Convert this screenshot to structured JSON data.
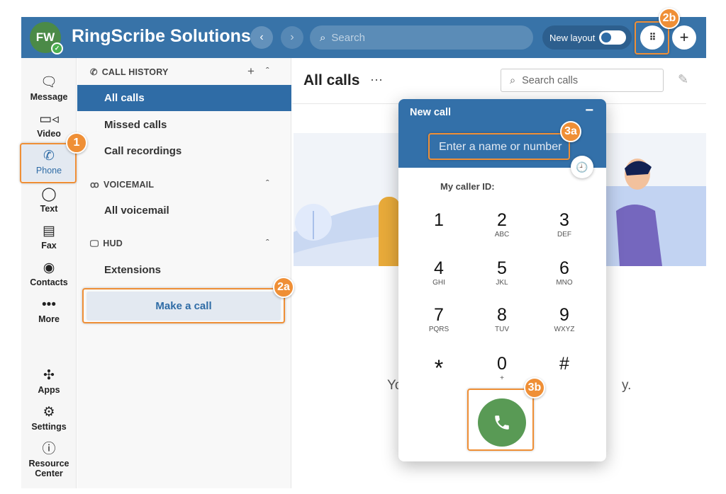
{
  "header": {
    "avatar_initials": "FW",
    "app_title": "RingScribe Solutions",
    "search_placeholder": "Search",
    "new_layout_label": "New layout",
    "new_layout_on": true,
    "brand_color": "#3873a8"
  },
  "rail": {
    "items": [
      {
        "label": "Message",
        "icon": "message-icon"
      },
      {
        "label": "Video",
        "icon": "video-icon"
      },
      {
        "label": "Phone",
        "icon": "phone-icon",
        "active": true
      },
      {
        "label": "Text",
        "icon": "chat-bubble-icon"
      },
      {
        "label": "Fax",
        "icon": "fax-icon"
      },
      {
        "label": "Contacts",
        "icon": "contact-icon"
      },
      {
        "label": "More",
        "icon": "more-icon"
      },
      {
        "label": "Apps",
        "icon": "puzzle-icon"
      },
      {
        "label": "Settings",
        "icon": "gear-icon"
      },
      {
        "label": "Resource Center",
        "icon": "help-icon"
      }
    ]
  },
  "sidebar": {
    "call_history": "CALL HISTORY",
    "all_calls": "All calls",
    "missed_calls": "Missed calls",
    "call_recordings": "Call recordings",
    "voicemail": "VOICEMAIL",
    "all_voicemail": "All voicemail",
    "hud": "HUD",
    "extensions": "Extensions",
    "make_call": "Make a call"
  },
  "main": {
    "title": "All calls",
    "search_placeholder": "Search calls",
    "empty_left": "Yo",
    "empty_right": "y."
  },
  "dialog": {
    "title": "New call",
    "input_placeholder": "Enter a name or number",
    "caller_id_label": "My caller ID:",
    "keys": [
      {
        "d": "1",
        "l": ""
      },
      {
        "d": "2",
        "l": "ABC"
      },
      {
        "d": "3",
        "l": "DEF"
      },
      {
        "d": "4",
        "l": "GHI"
      },
      {
        "d": "5",
        "l": "JKL"
      },
      {
        "d": "6",
        "l": "MNO"
      },
      {
        "d": "7",
        "l": "PQRS"
      },
      {
        "d": "8",
        "l": "TUV"
      },
      {
        "d": "9",
        "l": "WXYZ"
      },
      {
        "d": "*",
        "l": ""
      },
      {
        "d": "0",
        "l": "+"
      },
      {
        "d": "#",
        "l": ""
      }
    ],
    "call_color": "#599a55"
  },
  "annotations": {
    "a1": "1",
    "a2a": "2a",
    "a2b": "2b",
    "a3a": "3a",
    "a3b": "3b",
    "color": "#ef8f36"
  }
}
